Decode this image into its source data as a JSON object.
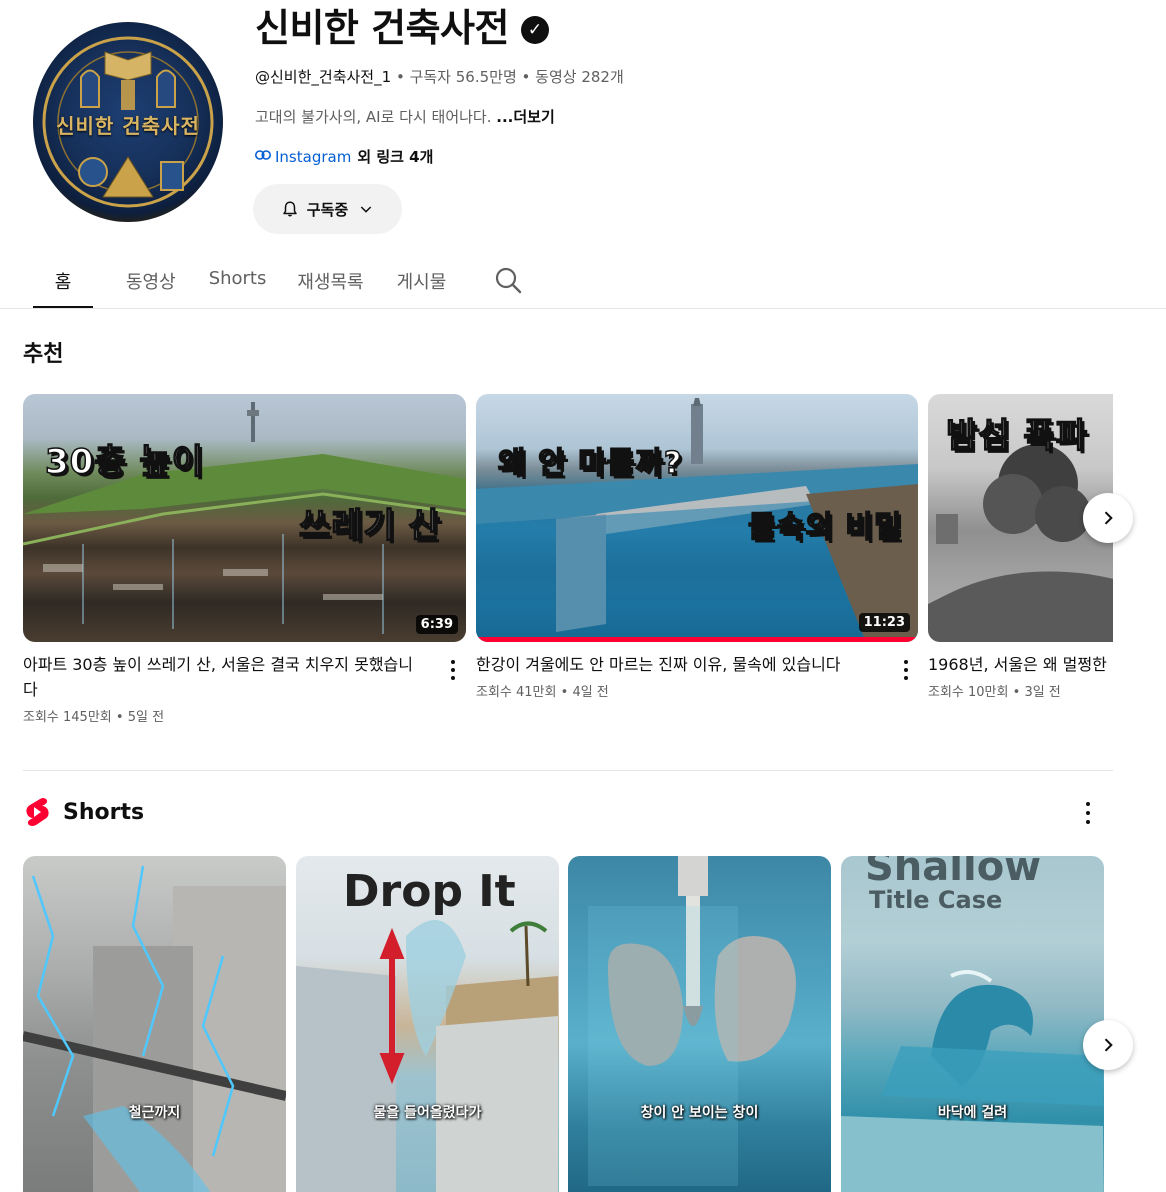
{
  "channel": {
    "avatar_text": "신비한 건축사전",
    "name": "신비한 건축사전",
    "handle": "@신비한_건축사전_1",
    "subscribers": "구독자 56.5만명",
    "video_count": "동영상 282개",
    "separator": "•",
    "description": "고대의 불가사의, AI로 다시 태어나다.",
    "more_label": "...더보기",
    "link_label": "Instagram",
    "more_links": "외 링크 4개",
    "subscribe_label": "구독중"
  },
  "tabs": [
    {
      "label": "홈"
    },
    {
      "label": "동영상"
    },
    {
      "label": "Shorts"
    },
    {
      "label": "재생목록"
    },
    {
      "label": "게시물"
    }
  ],
  "recommended": {
    "title": "추천",
    "videos": [
      {
        "title": "아파트 30층 높이 쓰레기 산, 서울은 결국 치우지 못했습니다",
        "views": "조회수 145만회",
        "age": "5일 전",
        "duration": "6:39",
        "overlay_top": "30층 높이",
        "overlay_bottom": "쓰레기 산"
      },
      {
        "title": "한강이 겨울에도 안 마르는 진짜 이유, 물속에 있습니다",
        "views": "조회수 41만회",
        "age": "4일 전",
        "duration": "11:23",
        "watched_fraction": 1.0,
        "overlay_top": "왜 안 마를까?",
        "overlay_bottom": "물속의 비밀"
      },
      {
        "title": "1968년, 서울은 왜 멀쩡한",
        "views": "조회수 10만회",
        "age": "3일 전",
        "overlay_top": "밤섬 폭파"
      }
    ]
  },
  "shorts": {
    "title": "Shorts",
    "items": [
      {
        "caption": "철근까지"
      },
      {
        "caption": "물을 들어올렸다가",
        "overlay": "Drop It"
      },
      {
        "caption": "창이 안 보이는 창이"
      },
      {
        "caption": "바닥에 걸려",
        "overlay_top": "Shallow",
        "overlay_sub": "Title Case"
      }
    ]
  },
  "icons": {
    "verified": "check-circle-icon",
    "link": "link-icon",
    "bell": "bell-icon",
    "chevron": "chevron-down-icon",
    "search": "search-icon",
    "next": "chevron-right-icon",
    "shorts_logo": "shorts-logo-icon",
    "more": "more-vert-icon"
  },
  "colors": {
    "link": "#065fd4",
    "progress": "#ff0033",
    "shorts_red": "#ff0033"
  }
}
